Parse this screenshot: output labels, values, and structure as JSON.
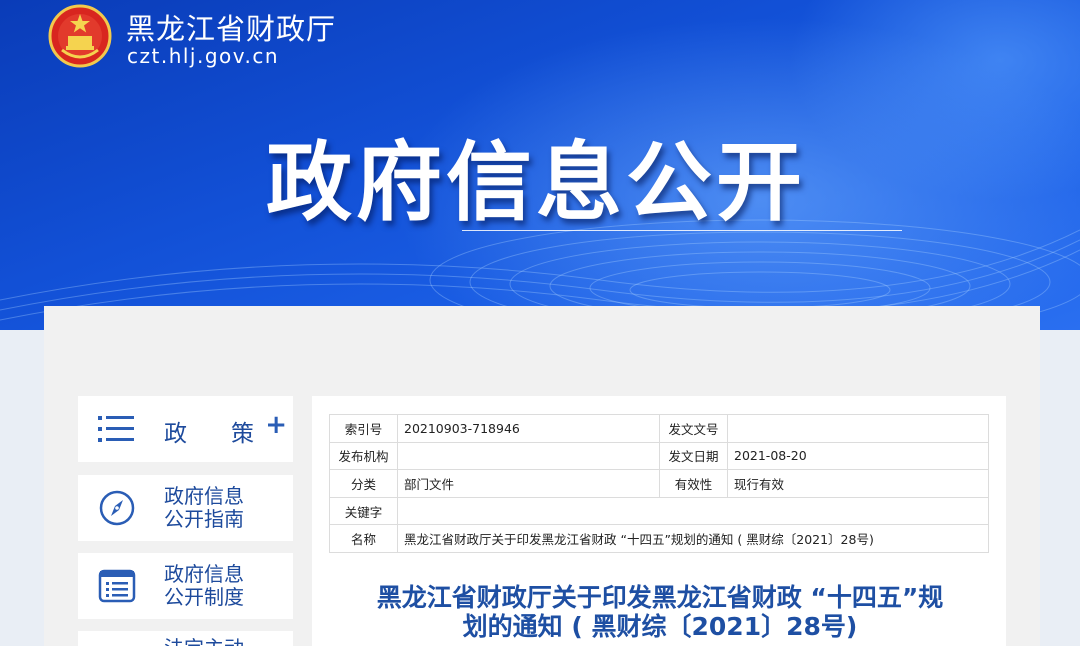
{
  "header": {
    "site_name": "黑龙江省财政厅",
    "site_domain": "czt.hlj.gov.cn",
    "banner_title": "政府信息公开",
    "emblem_icon": "national-emblem-icon"
  },
  "sidebar": {
    "items": [
      {
        "label": "政策",
        "icon": "list-icon",
        "expand": "+"
      },
      {
        "label": "政府信息\n公开指南",
        "icon": "compass-icon"
      },
      {
        "label": "政府信息\n公开制度",
        "icon": "document-list-icon"
      },
      {
        "label": "法定主动",
        "icon": ""
      }
    ]
  },
  "meta_table": {
    "index_label": "索引号",
    "index_value": "20210903-718946",
    "docno_label": "发文文号",
    "docno_value": "",
    "org_label": "发布机构",
    "org_value": "",
    "date_label": "发文日期",
    "date_value": "2021-08-20",
    "category_label": "分类",
    "category_value": "部门文件",
    "validity_label": "有效性",
    "validity_value": "现行有效",
    "keywords_label": "关键字",
    "keywords_value": "",
    "name_label": "名称",
    "name_value": "黑龙江省财政厅关于印发黑龙江省财政 “十四五”规划的通知 ( 黑财综〔2021〕28号)"
  },
  "document": {
    "title_line1": "黑龙江省财政厅关于印发黑龙江省财政 “十四五”规",
    "title_line2": "划的通知 ( 黑财综〔2021〕28号)"
  },
  "colors": {
    "banner_blue": "#1250d6",
    "title_blue": "#1e4fa3",
    "sidebar_text": "#1d4a9c"
  }
}
